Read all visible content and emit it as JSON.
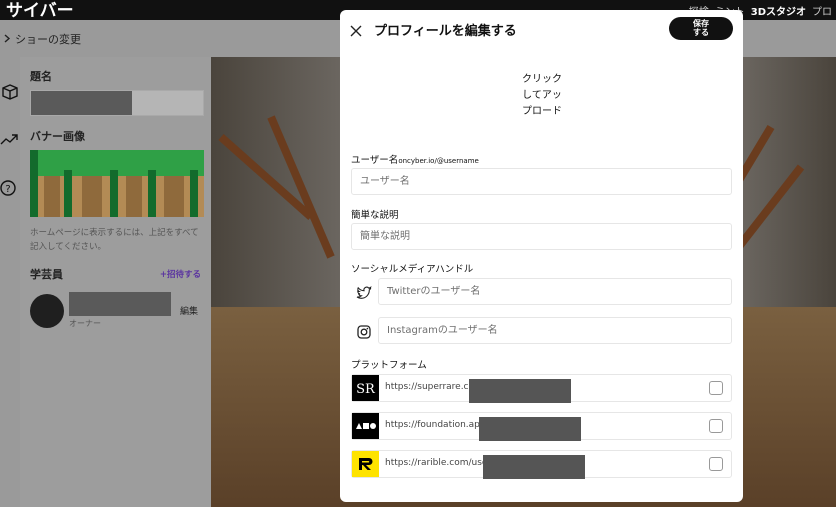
{
  "app": {
    "brand": "サイバー",
    "nav": [
      "探検",
      "ミント",
      "3Dスタジオ",
      "プロ"
    ]
  },
  "subheader": {
    "back_label": "ショーの変更"
  },
  "sidebar": {
    "title_label": "題名",
    "banner_label": "バナー画像",
    "hint": "ホームページに表示するには、上記をすべて記入してください。",
    "curators_label": "学芸員",
    "invite_label": "+招待する",
    "member_role": "オーナー",
    "member_edit": "編集"
  },
  "modal": {
    "title": "プロフィールを編集する",
    "save_label": "保存\nする",
    "upload_label": "クリック\nしてアッ\nプロード",
    "username_label": "ユーザー名",
    "username_hint": "oncyber.io/@username",
    "username_placeholder": "ユーザー名",
    "desc_label": "簡単な説明",
    "desc_placeholder": "簡単な説明",
    "social_label": "ソーシャルメディアハンドル",
    "twitter_placeholder": "Twitterのユーザー名",
    "instagram_placeholder": "Instagramのユーザー名",
    "platform_label": "プラットフォーム",
    "platforms": [
      {
        "url": "https://superrare.co/",
        "logo": "superrare-logo"
      },
      {
        "url": "https://foundation.app/",
        "logo": "foundation-logo"
      },
      {
        "url": "https://rarible.com/user/",
        "logo": "rarible-logo"
      }
    ]
  },
  "colors": {
    "accent": "#111111",
    "invite": "#5b35a0",
    "rarible": "#fee300"
  }
}
